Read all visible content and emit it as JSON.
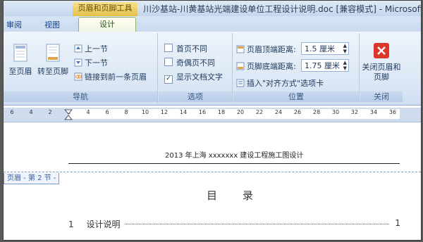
{
  "title_bar": {
    "context_tab": "页眉和页脚工具",
    "document_title": "川沙基站-川黄基站光端建设单位工程设计说明.doc [兼容模式] - Microsoft W"
  },
  "tabs": [
    {
      "label": "审阅",
      "active": false
    },
    {
      "label": "视图",
      "active": false
    },
    {
      "label": "设计",
      "active": true
    }
  ],
  "ribbon": {
    "nav": {
      "label": "导航",
      "goto_header": "至页眉",
      "goto_footer": "转至页脚",
      "prev_section": "上一节",
      "next_section": "下一节",
      "link_previous": "链接到前一条页眉"
    },
    "options": {
      "label": "选项",
      "first_page": {
        "text": "首页不同",
        "checked": false
      },
      "odd_even": {
        "text": "奇偶页不同",
        "checked": false
      },
      "show_doc_text": {
        "text": "显示文档文字",
        "checked": true
      }
    },
    "position": {
      "label": "位置",
      "header_top_label": "页眉顶端距离:",
      "header_top_value": "1.5 厘米",
      "footer_bottom_label": "页脚底端距离:",
      "footer_bottom_value": "1.75 厘米",
      "insert_align_tab": "插入\"对齐方式\"选项卡"
    },
    "close": {
      "label": "关闭",
      "close_button": "关闭页眉和页脚"
    }
  },
  "ruler": {
    "ticks": [
      "6",
      "4",
      "2",
      "2",
      "4",
      "6",
      "8",
      "10",
      "12",
      "14",
      "16",
      "18",
      "20",
      "22",
      "24",
      "26",
      "28",
      "30",
      "32",
      "34",
      "36"
    ]
  },
  "document": {
    "header_text": "2013 年上海 xxxxxxx 建设工程施工图设计",
    "header_tag": "页眉 - 第 2 节 -",
    "toc_title": "目录",
    "toc_entries": [
      {
        "number": "1",
        "title": "设计说明",
        "page": "1"
      }
    ]
  },
  "colors": {
    "accent_context": "#e4c04c",
    "ribbon_bg": "#dbe7f5",
    "close_red": "#d9372c"
  }
}
